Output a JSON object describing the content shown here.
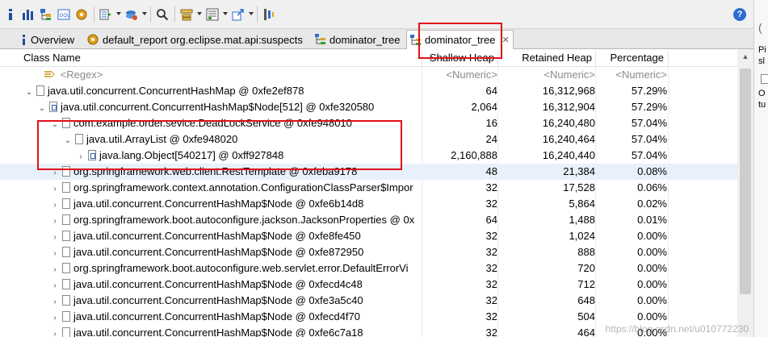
{
  "tabs": [
    {
      "label": "Overview",
      "icon": "info-icon"
    },
    {
      "label": "default_report  org.eclipse.mat.api:suspects",
      "icon": "report-icon"
    },
    {
      "label": "dominator_tree",
      "icon": "tree-icon"
    },
    {
      "label": "dominator_tree",
      "icon": "tree-icon",
      "active": true
    }
  ],
  "columns": {
    "name": "Class Name",
    "shallow": "Shallow Heap",
    "retained": "Retained Heap",
    "percentage": "Percentage"
  },
  "filter_row": {
    "name": "<Regex>",
    "shallow": "<Numeric>",
    "retained": "<Numeric>",
    "percentage": "<Numeric>"
  },
  "rows": [
    {
      "name": "java.util.concurrent.ConcurrentHashMap @ 0xfe2ef878",
      "shallow": "64",
      "retained": "16,312,968",
      "percentage": "57.29%"
    },
    {
      "name": "java.util.concurrent.ConcurrentHashMap$Node[512] @ 0xfe320580",
      "shallow": "2,064",
      "retained": "16,312,904",
      "percentage": "57.29%"
    },
    {
      "name": "com.example.order.sevice.DeadLockService @ 0xfe948010",
      "shallow": "16",
      "retained": "16,240,480",
      "percentage": "57.04%"
    },
    {
      "name": "java.util.ArrayList @ 0xfe948020",
      "shallow": "24",
      "retained": "16,240,464",
      "percentage": "57.04%"
    },
    {
      "name": "java.lang.Object[540217] @ 0xff927848",
      "shallow": "2,160,888",
      "retained": "16,240,440",
      "percentage": "57.04%"
    },
    {
      "name": "org.springframework.web.client.RestTemplate @ 0xfeba9178",
      "shallow": "48",
      "retained": "21,384",
      "percentage": "0.08%"
    },
    {
      "name": "org.springframework.context.annotation.ConfigurationClassParser$Impor",
      "shallow": "32",
      "retained": "17,528",
      "percentage": "0.06%"
    },
    {
      "name": "java.util.concurrent.ConcurrentHashMap$Node @ 0xfe6b14d8",
      "shallow": "32",
      "retained": "5,864",
      "percentage": "0.02%"
    },
    {
      "name": "org.springframework.boot.autoconfigure.jackson.JacksonProperties @ 0x",
      "shallow": "64",
      "retained": "1,488",
      "percentage": "0.01%"
    },
    {
      "name": "java.util.concurrent.ConcurrentHashMap$Node @ 0xfe8fe450",
      "shallow": "32",
      "retained": "1,024",
      "percentage": "0.00%"
    },
    {
      "name": "java.util.concurrent.ConcurrentHashMap$Node @ 0xfe872950",
      "shallow": "32",
      "retained": "888",
      "percentage": "0.00%"
    },
    {
      "name": "org.springframework.boot.autoconfigure.web.servlet.error.DefaultErrorVi",
      "shallow": "32",
      "retained": "720",
      "percentage": "0.00%"
    },
    {
      "name": "java.util.concurrent.ConcurrentHashMap$Node @ 0xfecd4c48",
      "shallow": "32",
      "retained": "712",
      "percentage": "0.00%"
    },
    {
      "name": "java.util.concurrent.ConcurrentHashMap$Node @ 0xfe3a5c40",
      "shallow": "32",
      "retained": "648",
      "percentage": "0.00%"
    },
    {
      "name": "java.util.concurrent.ConcurrentHashMap$Node @ 0xfecd4f70",
      "shallow": "32",
      "retained": "504",
      "percentage": "0.00%"
    },
    {
      "name": "java.util.concurrent.ConcurrentHashMap$Node @ 0xfe6c7a18",
      "shallow": "32",
      "retained": "464",
      "percentage": "0.00%"
    }
  ],
  "side_panel": {
    "line1": "Pi",
    "line2": "sl",
    "line3": "O",
    "line4": "tu"
  },
  "watermark": "https://blog.csdn.net/u010772230",
  "colors": {
    "highlight_box": "#e0101a",
    "selected_row": "#e8f1fb"
  }
}
